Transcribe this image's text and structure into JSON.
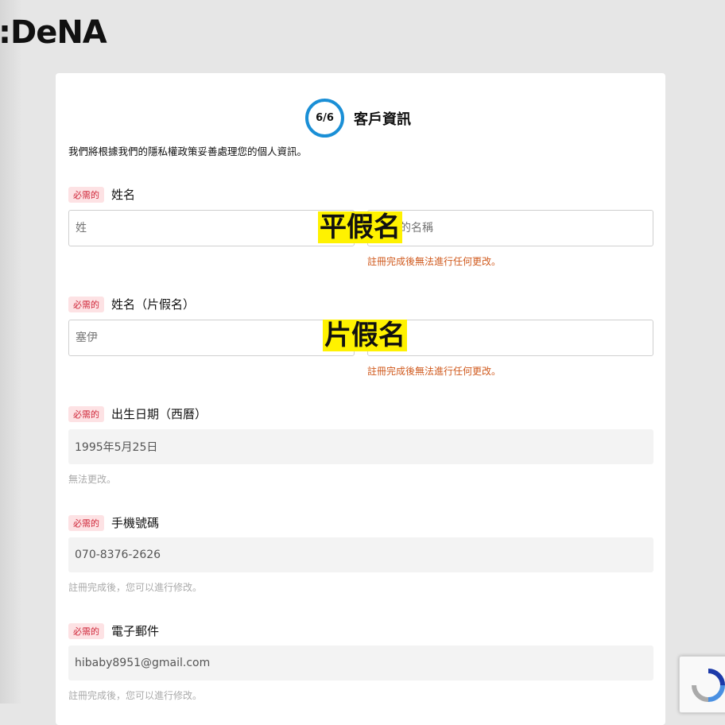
{
  "brand": {
    "logo_text": ":DeNA"
  },
  "step": {
    "indicator": "6/6",
    "title": "客戶資訊"
  },
  "intro_text": "我們將根據我們的隱私權政策妥善處理您的個人資訊。",
  "required_badge": "必需的",
  "fields": {
    "name": {
      "label": "姓名",
      "last_placeholder": "姓",
      "first_placeholder": "的名稱",
      "note": "註冊完成後無法進行任何更改。",
      "overlay": "平假名"
    },
    "katakana": {
      "label": "姓名（片假名）",
      "last_placeholder": "塞伊",
      "first_placeholder": "",
      "note": "註冊完成後無法進行任何更改。",
      "overlay": "片假名"
    },
    "birthdate": {
      "label": "出生日期（西曆）",
      "value": "1995年5月25日",
      "note": "無法更改。"
    },
    "phone": {
      "label": "手機號碼",
      "value": "070-8376-2626",
      "note": "註冊完成後，您可以進行修改。"
    },
    "email": {
      "label": "電子郵件",
      "value": "hibaby8951@gmail.com",
      "note": "註冊完成後，您可以進行修改。"
    }
  },
  "colors": {
    "accent": "#1a8fd6",
    "required_bg": "#fde2e4",
    "required_fg": "#d0283a",
    "warn": "#d05a1e",
    "highlight": "#fff200"
  }
}
